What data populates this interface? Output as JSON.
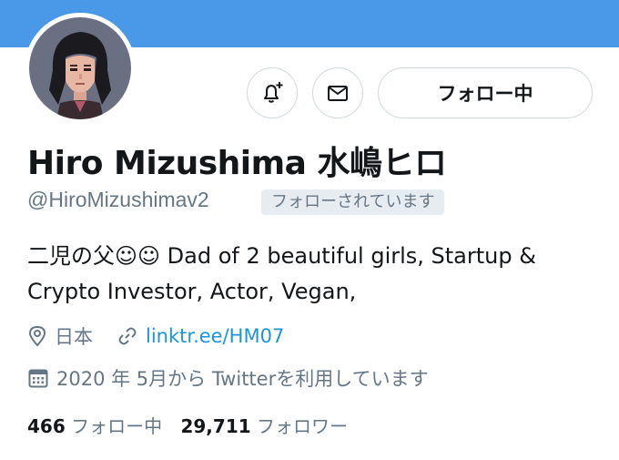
{
  "profile": {
    "display_name": "Hiro Mizushima 水嶋ヒロ",
    "handle": "@HiroMizushimav2",
    "follows_you_badge": "フォローされています",
    "bio_line1": "二児の父☺☺ Dad of 2 beautiful girls, Startup &",
    "bio_line2": "Crypto Investor, Actor, Vegan,",
    "location": "日本",
    "website": "linktr.ee/HM07",
    "joined": "2020 年 5月から Twitterを利用しています"
  },
  "actions": {
    "notify_icon": "bell-plus-icon",
    "message_icon": "envelope-icon",
    "following_label": "フォロー中"
  },
  "stats": {
    "following_count": "466",
    "following_label": "フォロー中",
    "followers_count": "29,711",
    "followers_label": "フォロワー"
  },
  "icons": {
    "location": "map-pin-icon",
    "link": "link-icon",
    "calendar": "calendar-icon"
  },
  "colors": {
    "banner": "#4a99e9",
    "link": "#1b95e0",
    "secondary_text": "#657786",
    "border": "#cfd9de"
  }
}
